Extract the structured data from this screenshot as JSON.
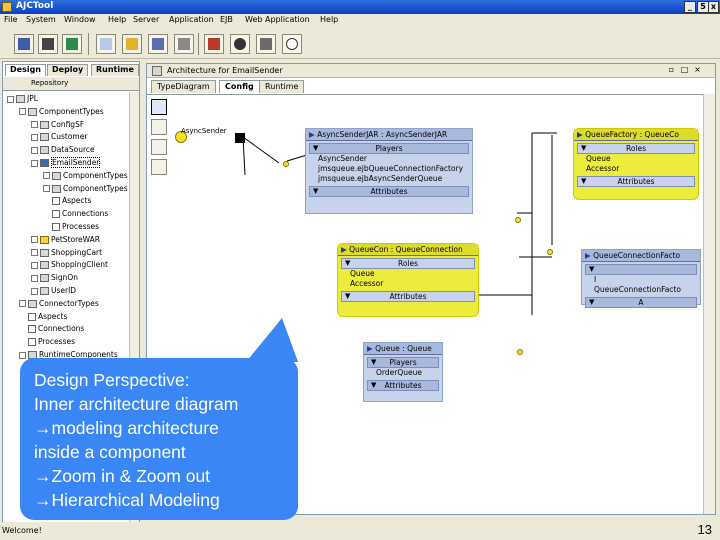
{
  "window": {
    "title": "AJCTool",
    "buttons": [
      "_",
      "5",
      "x"
    ]
  },
  "menu": [
    "File",
    "System",
    "Window",
    "Help",
    "Server",
    "Application",
    "EJB",
    "Web Application",
    "Help"
  ],
  "toolbar_icons": [
    "save-icon",
    "cut-icon",
    "paste-icon",
    "document-icon",
    "component-icon",
    "ejb-icon",
    "tools-icon",
    "film-icon",
    "eye-icon",
    "pencil-icon",
    "help-icon"
  ],
  "left_panel": {
    "tabs": [
      "Design",
      "Deploy",
      "Runtime"
    ],
    "active_tab": "Design",
    "repository_label": "Repository",
    "tree": [
      {
        "label": "JPL",
        "indent": 0,
        "type": "root"
      },
      {
        "label": "ComponentTypes",
        "indent": 1,
        "type": "folder"
      },
      {
        "label": "ConfigSF",
        "indent": 2,
        "type": "folder"
      },
      {
        "label": "Customer",
        "indent": 2,
        "type": "folder"
      },
      {
        "label": "DataSource",
        "indent": 2,
        "type": "folder"
      },
      {
        "label": "EmailSender",
        "indent": 2,
        "type": "selected"
      },
      {
        "label": "ComponentTypes",
        "indent": 3,
        "type": "folder"
      },
      {
        "label": "ComponentTypes",
        "indent": 3,
        "type": "folder"
      },
      {
        "label": "Aspects",
        "indent": 3,
        "type": "leaf"
      },
      {
        "label": "Connections",
        "indent": 3,
        "type": "leaf"
      },
      {
        "label": "Processes",
        "indent": 3,
        "type": "leaf"
      },
      {
        "label": "PetStoreWAR",
        "indent": 2,
        "type": "yellow"
      },
      {
        "label": "ShoppingCart",
        "indent": 2,
        "type": "folder"
      },
      {
        "label": "ShoppingClient",
        "indent": 2,
        "type": "folder"
      },
      {
        "label": "SignOn",
        "indent": 2,
        "type": "folder"
      },
      {
        "label": "UserID",
        "indent": 2,
        "type": "folder"
      },
      {
        "label": "ConnectorTypes",
        "indent": 1,
        "type": "folder"
      },
      {
        "label": "Aspects",
        "indent": 1,
        "type": "leaf"
      },
      {
        "label": "Connections",
        "indent": 1,
        "type": "leaf"
      },
      {
        "label": "Processes",
        "indent": 1,
        "type": "leaf"
      },
      {
        "label": "RuntimeComponents",
        "indent": 1,
        "type": "folder"
      }
    ]
  },
  "editor": {
    "title": "Architecture for EmailSender",
    "tabs": [
      "TypeDiagram",
      "Config",
      "Runtime"
    ],
    "active_tab": "Config",
    "port_label": "AsyncSender"
  },
  "components": [
    {
      "id": "async-sender",
      "header": "AsyncSenderJAR : AsyncSenderJAR",
      "style": "blue",
      "sections": [
        {
          "title": "Players",
          "items": [
            "AsyncSender",
            "jmsqueue.ejbQueueConnectionFactory",
            "jmsqueue.ejbAsyncSenderQueue"
          ]
        },
        {
          "title": "Attributes",
          "items": []
        }
      ]
    },
    {
      "id": "queue-factory",
      "header": "QueueFactory : QueueCo",
      "style": "yellow",
      "sections": [
        {
          "title": "Roles",
          "items": [
            "Queue",
            "Accessor"
          ]
        },
        {
          "title": "Attributes",
          "items": []
        }
      ]
    },
    {
      "id": "queue-con",
      "header": "QueueCon : QueueConnection",
      "style": "yellow",
      "sections": [
        {
          "title": "Roles",
          "items": [
            "Queue",
            "Accessor"
          ]
        },
        {
          "title": "Attributes",
          "items": []
        }
      ]
    },
    {
      "id": "queue-connection-factory",
      "header": "QueueConnectionFacto",
      "style": "blue",
      "sections": [
        {
          "title": "",
          "items": [
            "I",
            "QueueConnectionFacto"
          ]
        },
        {
          "title": "A",
          "items": []
        }
      ]
    },
    {
      "id": "queue",
      "header": "Queue : Queue",
      "style": "blue",
      "sections": [
        {
          "title": "Players",
          "items": [
            "OrderQueue"
          ]
        },
        {
          "title": "Attributes",
          "items": []
        }
      ]
    }
  ],
  "callout": {
    "lines": [
      "Design Perspective:",
      "Inner architecture diagram",
      "→modeling architecture",
      "inside a component",
      "→Zoom in & Zoom out",
      "→Hierarchical Modeling"
    ],
    "color": "#3a86f5"
  },
  "status": {
    "text": "Welcome!",
    "page_number": "13"
  }
}
